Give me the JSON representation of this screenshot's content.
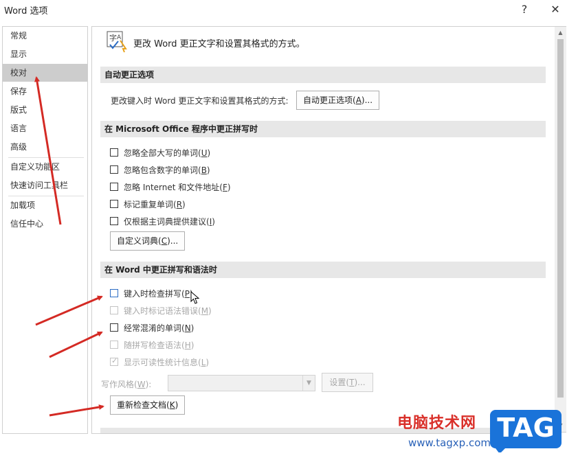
{
  "window": {
    "title": "Word 选项",
    "help_label": "?",
    "close_label": "✕"
  },
  "sidebar": {
    "items": [
      {
        "label": "常规"
      },
      {
        "label": "显示"
      },
      {
        "label": "校对",
        "selected": true
      },
      {
        "label": "保存"
      },
      {
        "label": "版式"
      },
      {
        "label": "语言"
      },
      {
        "label": "高级"
      },
      {
        "label": "自定义功能区"
      },
      {
        "label": "快速访问工具栏"
      },
      {
        "label": "加载项"
      },
      {
        "label": "信任中心"
      }
    ]
  },
  "content": {
    "header": "更改 Word 更正文字和设置其格式的方式。",
    "header_icon": "proofing-abc-check-icon",
    "autocorrect_section": {
      "title": "自动更正选项",
      "row_label": "更改键入时 Word 更正文字和设置其格式的方式:",
      "button_pre": "自动更正选项(",
      "button_key": "A",
      "button_post": ")..."
    },
    "office_section": {
      "title": "在 Microsoft Office 程序中更正拼写时",
      "checkboxes": [
        {
          "pre": "忽略全部大写的单词(",
          "key": "U",
          "post": ")",
          "checked": false
        },
        {
          "pre": "忽略包含数字的单词(",
          "key": "B",
          "post": ")",
          "checked": false
        },
        {
          "pre": "忽略 Internet 和文件地址(",
          "key": "F",
          "post": ")",
          "checked": false
        },
        {
          "pre": "标记重复单词(",
          "key": "R",
          "post": ")",
          "checked": false
        },
        {
          "pre": "仅根据主词典提供建议(",
          "key": "I",
          "post": ")",
          "checked": false
        }
      ],
      "dict_button_pre": "自定义词典(",
      "dict_button_key": "C",
      "dict_button_post": ")..."
    },
    "word_section": {
      "title": "在 Word 中更正拼写和语法时",
      "checkboxes": [
        {
          "pre": "键入时检查拼写(",
          "key": "P",
          "post": ")",
          "checked": false,
          "disabled": false
        },
        {
          "pre": "键入时标记语法错误(",
          "key": "M",
          "post": ")",
          "checked": false,
          "disabled": true
        },
        {
          "pre": "经常混淆的单词(",
          "key": "N",
          "post": ")",
          "checked": false,
          "disabled": false
        },
        {
          "pre": "随拼写检查语法(",
          "key": "H",
          "post": ")",
          "checked": false,
          "disabled": true
        },
        {
          "pre": "显示可读性统计信息(",
          "key": "L",
          "post": ")",
          "checked": true,
          "disabled": true
        }
      ],
      "style_label_pre": "写作风格(",
      "style_label_key": "W",
      "style_label_post": "):",
      "style_value": "",
      "settings_button_pre": "设置(",
      "settings_button_key": "T",
      "settings_button_post": ")...",
      "recheck_button_pre": "重新检查文档(",
      "recheck_button_key": "K",
      "recheck_button_post": ")"
    }
  },
  "watermark": {
    "site_name": "电脑技术网",
    "url": "www.tagxp.com",
    "logo": "TAG"
  },
  "colors": {
    "annotation_arrow": "#d42a24",
    "selected_nav": "#cdcdcd",
    "section_bg": "#e7e7e7",
    "watermark_tag_bg": "#1a73d9"
  }
}
